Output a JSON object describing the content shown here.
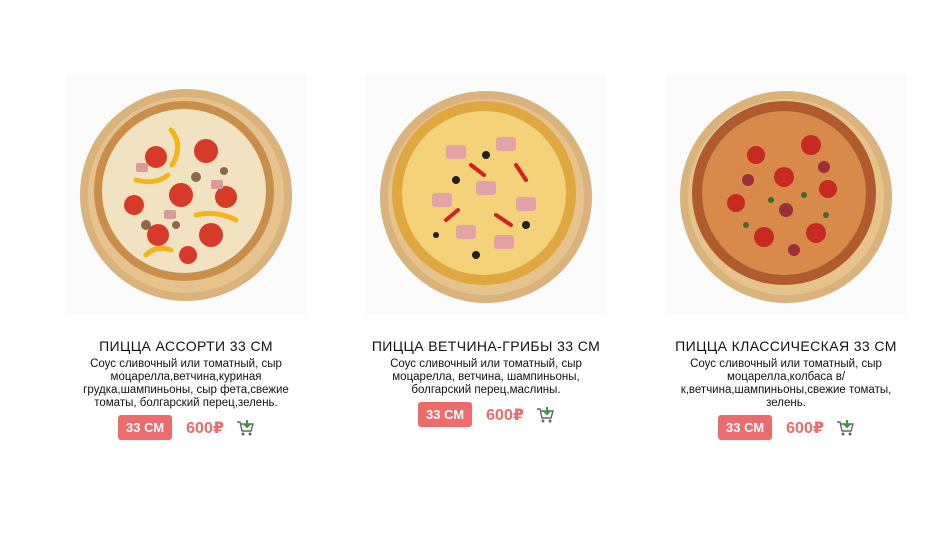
{
  "products": [
    {
      "title": "ПИЦЦА АССОРТИ 33 СМ",
      "description": "Соус сливочный или томатный, сыр моцарелла,ветчина,куриная грудка,шампиньоны, сыр фета,свежие томаты, болгарский перец,зелень.",
      "size_label": "33 СМ",
      "price": "600₽",
      "cart_icon": "add-to-cart-icon"
    },
    {
      "title": "ПИЦЦА ВЕТЧИНА-ГРИБЫ 33 СМ",
      "description": "Соус сливочный или томатный, сыр моцарелла, ветчина, шампиньоны, болгарский перец,маслины.",
      "size_label": "33 СМ",
      "price": "600₽",
      "cart_icon": "add-to-cart-icon"
    },
    {
      "title": "ПИЦЦА КЛАССИЧЕСКАЯ 33 СМ",
      "description": "Соус сливочный или томатный, сыр моцарелла,колбаса в/к,ветчина,шампиньоны,свежие томаты, зелень.",
      "size_label": "33 СМ",
      "price": "600₽",
      "cart_icon": "add-to-cart-icon"
    }
  ],
  "colors": {
    "accent": "#ee6b6b",
    "text": "#111111",
    "background": "#ffffff",
    "cart_green": "#3e9a3e"
  }
}
